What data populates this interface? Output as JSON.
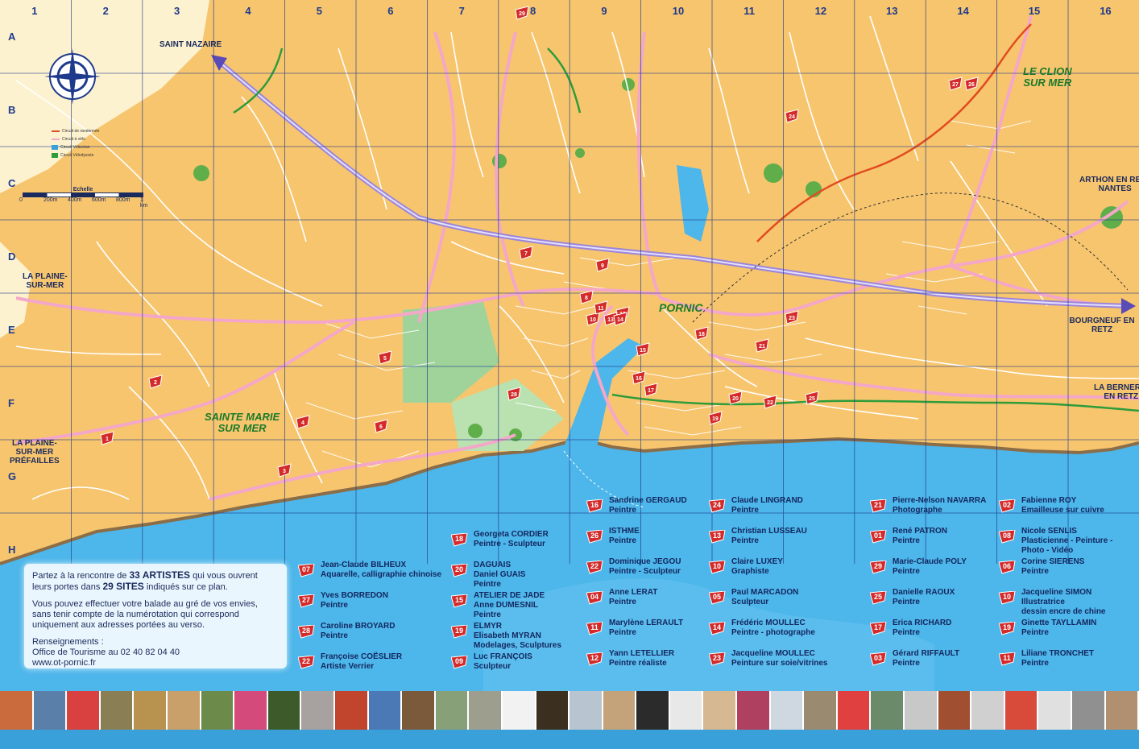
{
  "grid": {
    "columns": [
      "1",
      "2",
      "3",
      "4",
      "5",
      "6",
      "7",
      "8",
      "9",
      "10",
      "11",
      "12",
      "13",
      "14",
      "15",
      "16"
    ],
    "rows": [
      "A",
      "B",
      "C",
      "D",
      "E",
      "F",
      "G",
      "H"
    ]
  },
  "places": {
    "saint_nazaire": "SAINT NAZAIRE",
    "la_plaine": "LA PLAINE-\nSUR-MER",
    "la_plaine_prefailles": "LA PLAINE-\nSUR-MER\nPRÉFAILLES",
    "arthon": "ARTHON EN RETZ\nNANTES",
    "bourgneuf": "BOURGNEUF EN RETZ",
    "la_bernerie": "LA BERNERIE\nEN RETZ",
    "le_clion": "LE CLION\nSUR MER",
    "sainte_marie": "SAINTE MARIE\nSUR MER",
    "pornic": "PORNIC"
  },
  "legend": {
    "items": [
      "Circuit de randonnée",
      "Circuit à vélo",
      "Circuit Vélocéan",
      "Circuit Vélodyssée"
    ],
    "scale_title": "Echelle",
    "scale_ticks": [
      "0",
      "200m",
      "400m",
      "600m",
      "800m",
      "1 km"
    ]
  },
  "info": {
    "line1a": "Partez à la rencontre de ",
    "line1b": "33 ARTISTES",
    "line1c": " qui vous ouvrent leurs portes dans ",
    "line1d": "29 SITES",
    "line1e": " indiqués sur ce plan.",
    "line2": "Vous pouvez effectuer votre balade au gré de vos envies, sans tenir compte de la numérotation qui correspond uniquement aux adresses portées au verso.",
    "line3": "Renseignements :",
    "line4": "Office de Tourisme au 02 40 82 04 40",
    "line5": "www.ot-pornic.fr"
  },
  "artists": [
    {
      "num": "07",
      "name": "Jean-Claude BILHEUX",
      "job": "Aquarelle, calligraphie chinoise"
    },
    {
      "num": "27",
      "name": "Yves BORREDON",
      "job": "Peintre"
    },
    {
      "num": "28",
      "name": "Caroline BROYARD",
      "job": "Peintre"
    },
    {
      "num": "22",
      "name": "Françoise COËSLIER",
      "job": "Artiste Verrier"
    },
    {
      "num": "18",
      "name": "Georgeta CORDIER",
      "job": "Peintre - Sculpteur"
    },
    {
      "num": "20",
      "name": "DAGUAIS",
      "job": "Daniel GUAIS\nPeintre"
    },
    {
      "num": "15",
      "name": "ATELIER DE JADE",
      "job": "Anne DUMESNIL\nPeintre"
    },
    {
      "num": "19",
      "name": "ELMYR",
      "job": "Elisabeth MYRAN\nModelages, Sculptures"
    },
    {
      "num": "09",
      "name": "Luc FRANÇOIS",
      "job": "Sculpteur"
    },
    {
      "num": "16",
      "name": "Sandrine GERGAUD",
      "job": "Peintre"
    },
    {
      "num": "26",
      "name": "ISTHME",
      "job": "Peintre"
    },
    {
      "num": "22",
      "name": "Dominique JEGOU",
      "job": "Peintre - Sculpteur"
    },
    {
      "num": "04",
      "name": "Anne LERAT",
      "job": "Peintre"
    },
    {
      "num": "11",
      "name": "Marylène LERAULT",
      "job": "Peintre"
    },
    {
      "num": "12",
      "name": "Yann LETELLIER",
      "job": "Peintre réaliste"
    },
    {
      "num": "24",
      "name": "Claude LINGRAND",
      "job": "Peintre"
    },
    {
      "num": "13",
      "name": "Christian LUSSEAU",
      "job": "Peintre"
    },
    {
      "num": "10",
      "name": "Claire LUXEY",
      "job": "Graphiste"
    },
    {
      "num": "05",
      "name": "Paul MARCADON",
      "job": "Sculpteur"
    },
    {
      "num": "14",
      "name": "Frédéric MOULLEC",
      "job": "Peintre - photographe"
    },
    {
      "num": "23",
      "name": "Jacqueline MOULLEC",
      "job": "Peinture sur soie/vitrines"
    },
    {
      "num": "21",
      "name": "Pierre-Nelson NAVARRA",
      "job": "Photographe"
    },
    {
      "num": "01",
      "name": "René PATRON",
      "job": "Peintre"
    },
    {
      "num": "29",
      "name": "Marie-Claude POLY",
      "job": "Peintre"
    },
    {
      "num": "25",
      "name": "Danielle RAOUX",
      "job": "Peintre"
    },
    {
      "num": "17",
      "name": "Erica RICHARD",
      "job": "Peintre"
    },
    {
      "num": "03",
      "name": "Gérard RIFFAULT",
      "job": "Peintre"
    },
    {
      "num": "02",
      "name": "Fabienne ROY",
      "job": "Emailleuse sur cuivre"
    },
    {
      "num": "08",
      "name": "Nicole SENLIS",
      "job": "Plasticienne - Peinture -\nPhoto - Vidéo"
    },
    {
      "num": "06",
      "name": "Corine SIERENS",
      "job": "Peintre"
    },
    {
      "num": "10",
      "name": "Jacqueline SIMON",
      "job": "Illustratrice\ndessin encre de chine"
    },
    {
      "num": "19",
      "name": "Ginette TAYLLAMIN",
      "job": "Peintre"
    },
    {
      "num": "11",
      "name": "Liliane TRONCHET",
      "job": "Peintre"
    }
  ],
  "map_markers": [
    "1",
    "2",
    "3",
    "4",
    "5",
    "6",
    "7",
    "8",
    "9",
    "10",
    "11",
    "12",
    "13",
    "14",
    "15",
    "16",
    "17",
    "18",
    "19",
    "20",
    "21",
    "22",
    "23",
    "24",
    "25",
    "26",
    "27",
    "28",
    "29"
  ],
  "colors": {
    "land": "#f7c56e",
    "sea": "#4db6ea",
    "road": "#f4a7c8",
    "grid": "#1e3a8c",
    "flag": "#d42a2a",
    "green": "#3f9c3f"
  }
}
